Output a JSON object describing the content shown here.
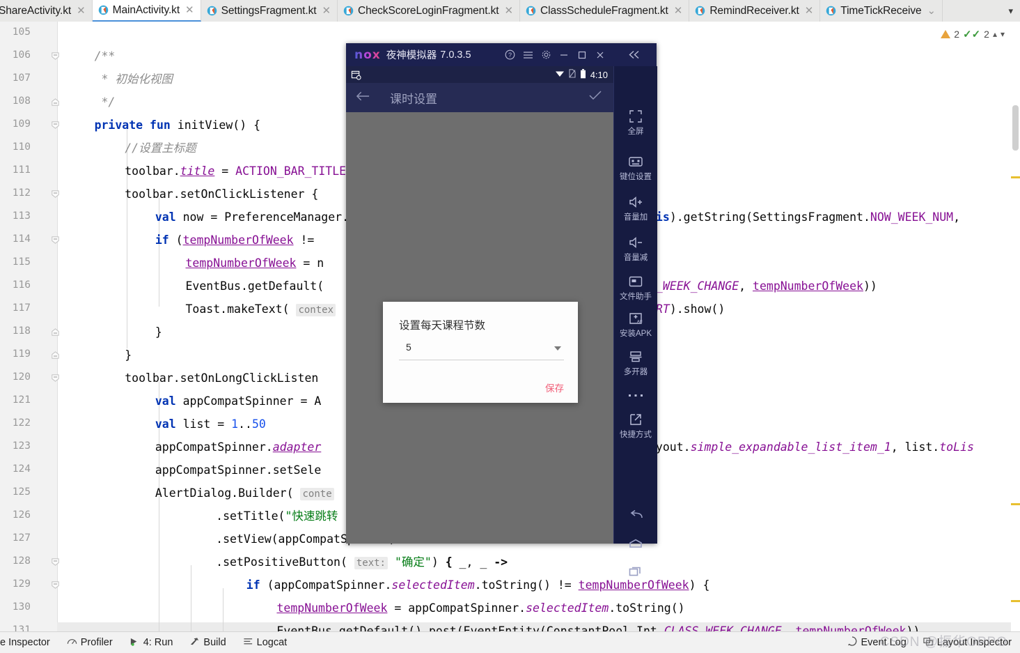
{
  "window": {
    "tabs": [
      {
        "label": "ShareActivity.kt",
        "active": false,
        "icon": "kotlin-file-icon",
        "truncated_left": true
      },
      {
        "label": "MainActivity.kt",
        "active": true,
        "icon": "kotlin-file-icon"
      },
      {
        "label": "SettingsFragment.kt",
        "active": false,
        "icon": "kotlin-file-icon"
      },
      {
        "label": "CheckScoreLoginFragment.kt",
        "active": false,
        "icon": "kotlin-file-icon"
      },
      {
        "label": "ClassScheduleFragment.kt",
        "active": false,
        "icon": "kotlin-file-icon"
      },
      {
        "label": "RemindReceiver.kt",
        "active": false,
        "icon": "kotlin-file-icon"
      },
      {
        "label": "TimeTickReceive",
        "active": false,
        "icon": "kotlin-file-icon"
      }
    ],
    "tab_overflow_icon": "chevron-down-icon"
  },
  "inspections": {
    "warning_icon": "warning-triangle-icon",
    "warning_count": "2",
    "ok_icon": "double-check-icon",
    "ok_count": "2",
    "prev_icon": "chevron-up-icon",
    "next_icon": "chevron-down-icon"
  },
  "editor": {
    "line_numbers": [
      "105",
      "106",
      "107",
      "108",
      "109",
      "110",
      "111",
      "112",
      "113",
      "114",
      "115",
      "116",
      "117",
      "118",
      "119",
      "120",
      "121",
      "122",
      "123",
      "124",
      "125",
      "126",
      "127",
      "128",
      "129",
      "130",
      "131"
    ],
    "lines": [
      {
        "n": "105",
        "text": ""
      },
      {
        "n": "106",
        "text": "        /**"
      },
      {
        "n": "107",
        "text": "         * 初始化视图"
      },
      {
        "n": "108",
        "text": "         */"
      },
      {
        "n": "109",
        "text": "        private fun initView() {"
      },
      {
        "n": "110",
        "text": "            //设置主标题"
      },
      {
        "n": "111",
        "text": "            toolbar.title = ACTION_BAR_TITLE"
      },
      {
        "n": "112",
        "text": "            toolbar.setOnClickListener {"
      },
      {
        "n": "113",
        "text": "                val now = PreferenceManager.getDefaultSharedPreferences(this).getString(SettingsFragment.NOW_WEEK_NUM,"
      },
      {
        "n": "114",
        "text": "                if (tempNumberOfWeek != now) {"
      },
      {
        "n": "115",
        "text": "                    tempNumberOfWeek = now"
      },
      {
        "n": "116",
        "text": "                    EventBus.getDefault().post(EventEntity(ConstantPool.Int.CLASS_WEEK_CHANGE, tempNumberOfWeek))"
      },
      {
        "n": "117",
        "text": "                    Toast.makeText( context: this, text: \"\", Toast.LENGTH_SHORT).show()"
      },
      {
        "n": "118",
        "text": "                }"
      },
      {
        "n": "119",
        "text": "            }"
      },
      {
        "n": "120",
        "text": "            toolbar.setOnLongClickListener {"
      },
      {
        "n": "121",
        "text": "                val appCompatSpinner = AppCompatSpinner(this)"
      },
      {
        "n": "122",
        "text": "                val list = 1..50"
      },
      {
        "n": "123",
        "text": "                appCompatSpinner.adapter = ArrayAdapter(this, android.R.layout.simple_expandable_list_item_1, list.toList"
      },
      {
        "n": "124",
        "text": "                appCompatSpinner.setSelection()"
      },
      {
        "n": "125",
        "text": "                AlertDialog.Builder( context: this)"
      },
      {
        "n": "126",
        "text": "                        .setTitle(\"快速跳转\")"
      },
      {
        "n": "127",
        "text": "                        .setView(appCompatSpinner)"
      },
      {
        "n": "128",
        "text": "                        .setPositiveButton( text: \"确定\") { _, _ ->"
      },
      {
        "n": "129",
        "text": "                            if (appCompatSpinner.selectedItem.toString() != tempNumberOfWeek) {"
      },
      {
        "n": "130",
        "text": "                                tempNumberOfWeek = appCompatSpinner.selectedItem.toString()"
      },
      {
        "n": "131",
        "text": "                                EventBus.getDefault().post(EventEntity(ConstantPool.Int.CLASS_WEEK_CHANGE, tempNumberOfWeek))"
      }
    ],
    "visible_fragments": {
      "l113_right": "his).getString(SettingsFragment.NOW_WEEK_NUM,",
      "l116_right": "S_WEEK_CHANGE, tempNumberOfWeek))",
      "l117_right": "ORT).show()",
      "l123_right": "ayout.simple_expandable_list_item_1, list.toLis"
    }
  },
  "emulator": {
    "brand": "nox",
    "title": "夜神模拟器",
    "version": "7.0.3.5",
    "titlebar_buttons": [
      {
        "name": "help-icon",
        "glyph": "?"
      },
      {
        "name": "menu-icon",
        "glyph": "☰"
      },
      {
        "name": "settings-gear-icon",
        "glyph": "⚙"
      },
      {
        "name": "minimize-icon",
        "glyph": "–"
      },
      {
        "name": "maximize-icon",
        "glyph": "▢"
      },
      {
        "name": "close-icon",
        "glyph": "✕"
      }
    ],
    "collapse_label": "«",
    "status_bar": {
      "left_icon": "calendar-sync-icon",
      "wifi_icon": "wifi-icon",
      "signal_icon": "no-sim-icon",
      "battery_icon": "battery-icon",
      "clock": "4:10"
    },
    "app_bar": {
      "back_icon": "arrow-left-icon",
      "title": "课时设置",
      "confirm_icon": "check-icon"
    },
    "dialog": {
      "title": "设置每天课程节数",
      "spinner_value": "5",
      "spinner_icon": "dropdown-caret-icon",
      "save_label": "保存",
      "save_color": "#f15f79"
    },
    "sidebar": [
      {
        "label": "全屏",
        "icon": "fullscreen-icon"
      },
      {
        "label": "键位设置",
        "icon": "keymap-icon"
      },
      {
        "label": "音量加",
        "icon": "volume-up-icon"
      },
      {
        "label": "音量减",
        "icon": "volume-down-icon"
      },
      {
        "label": "文件助手",
        "icon": "file-assistant-icon"
      },
      {
        "label": "安装APK",
        "icon": "install-apk-icon"
      },
      {
        "label": "多开器",
        "icon": "multi-instance-icon"
      },
      {
        "label": "",
        "icon": "more-dots-icon"
      },
      {
        "label": "快捷方式",
        "icon": "shortcut-icon"
      }
    ],
    "nav_buttons": [
      {
        "name": "android-back-icon"
      },
      {
        "name": "android-home-icon"
      },
      {
        "name": "android-recents-icon"
      }
    ]
  },
  "statusbar": {
    "left_items": [
      {
        "label": "e Inspector",
        "icon": ""
      },
      {
        "label": "Profiler",
        "icon": "profiler-icon"
      },
      {
        "label": "4: Run",
        "icon": "run-icon"
      },
      {
        "label": "Build",
        "icon": "build-hammer-icon"
      },
      {
        "label": "Logcat",
        "icon": "logcat-icon"
      }
    ],
    "right_items": [
      {
        "label": "Event Log",
        "icon": "event-log-icon"
      },
      {
        "label": "Layout Inspector",
        "icon": "layout-inspector-icon"
      }
    ]
  },
  "watermark": {
    "text": "CSDN @振华OPPO"
  }
}
